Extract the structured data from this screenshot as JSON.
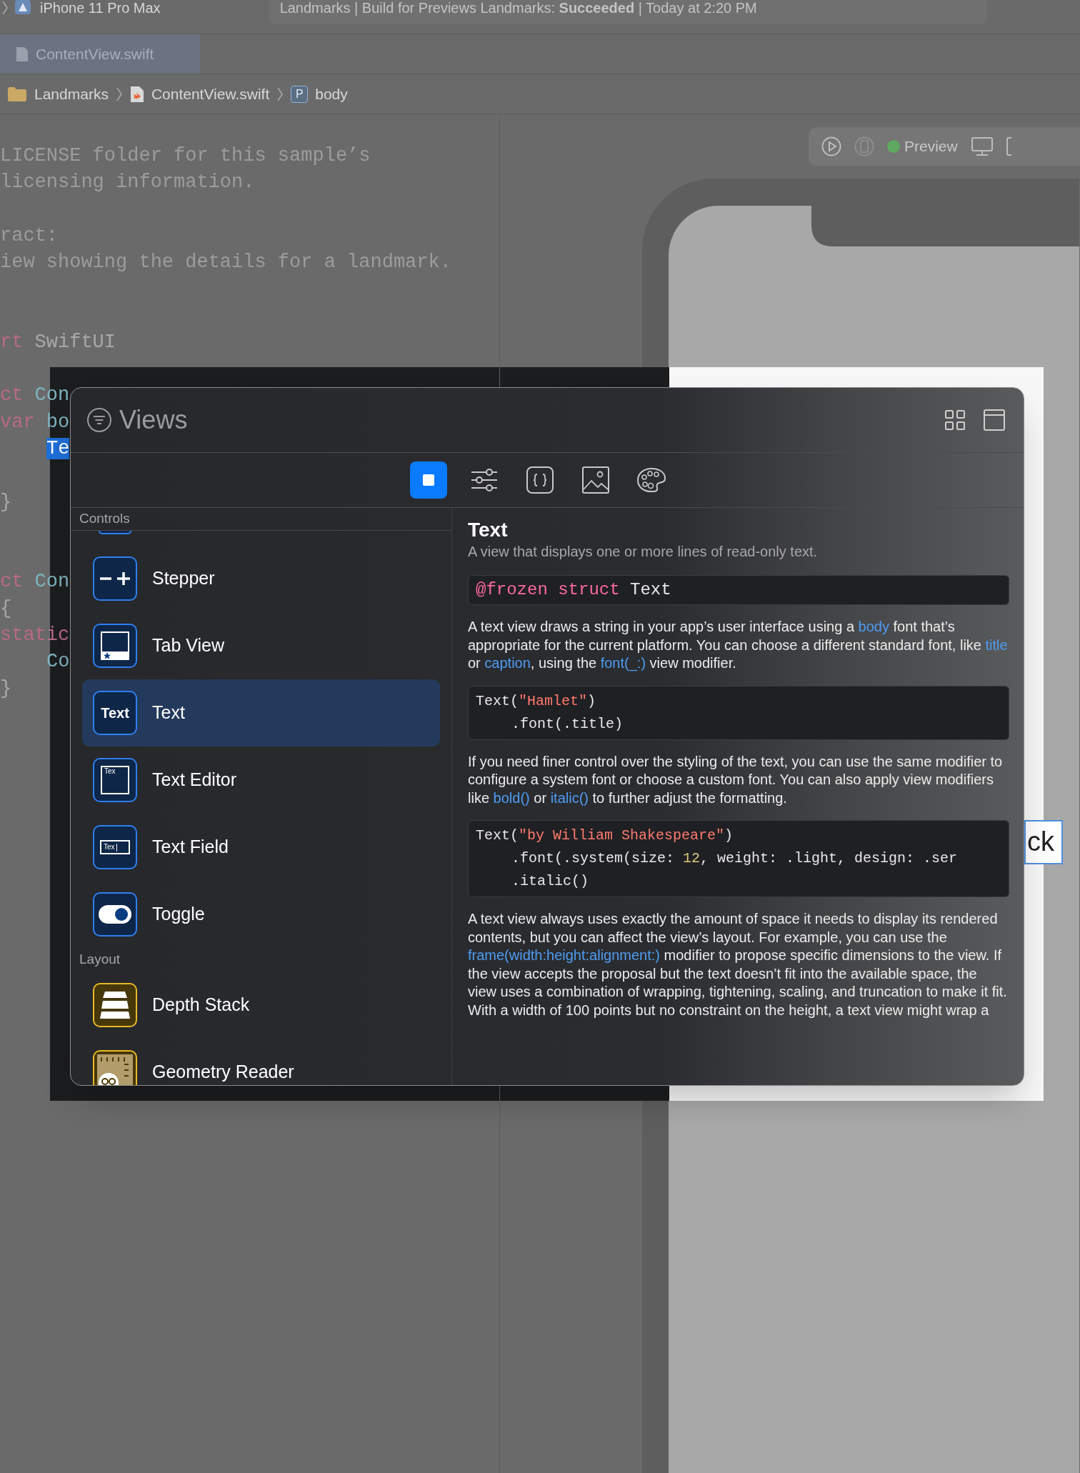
{
  "toolbar": {
    "device": "iPhone 11 Pro Max",
    "status": "Landmarks | Build for Previews Landmarks: **Succeeded** | Today at 2:20 PM"
  },
  "tabs": [
    {
      "label": "ContentView.swift",
      "selected": true
    }
  ],
  "breadcrumb": [
    {
      "label": "Landmarks",
      "kind": "folder"
    },
    {
      "label": "ContentView.swift",
      "kind": "file"
    },
    {
      "label": "body",
      "kind": "property",
      "badge": "P"
    }
  ],
  "editor": {
    "lines": [
      {
        "kind": "code",
        "tokens": [
          {
            "text": "LICENSE folder for this sample’s",
            "kind": "comment"
          }
        ]
      },
      {
        "kind": "code",
        "tokens": [
          {
            "text": "licensing information.",
            "kind": "comment"
          }
        ]
      },
      {
        "kind": "blank"
      },
      {
        "kind": "code",
        "tokens": [
          {
            "text": "ract:",
            "kind": "comment"
          }
        ]
      },
      {
        "kind": "code",
        "tokens": [
          {
            "text": "iew showing the details for a landmark.",
            "kind": "comment"
          }
        ]
      },
      {
        "kind": "blank"
      },
      {
        "kind": "blank"
      },
      {
        "kind": "code",
        "tokens": [
          {
            "text": "rt",
            "kind": "keyword"
          },
          {
            "text": " SwiftUI",
            "kind": "plain"
          }
        ]
      },
      {
        "kind": "blank"
      },
      {
        "kind": "code",
        "tokens": [
          {
            "text": "ct",
            "kind": "keyword"
          },
          {
            "text": " Con",
            "kind": "type"
          }
        ]
      },
      {
        "kind": "code",
        "tokens": [
          {
            "text": "var",
            "kind": "keyword"
          },
          {
            "text": " bo",
            "kind": "type"
          }
        ]
      },
      {
        "kind": "code",
        "indented": true,
        "tokens": [
          {
            "text": "Te",
            "kind": "selected"
          }
        ]
      },
      {
        "kind": "blank"
      },
      {
        "kind": "code",
        "tokens": [
          {
            "text": "}",
            "kind": "plain"
          }
        ]
      },
      {
        "kind": "blank"
      },
      {
        "kind": "blank"
      },
      {
        "kind": "code",
        "tokens": [
          {
            "text": "ct",
            "kind": "keyword"
          },
          {
            "text": " Con",
            "kind": "type"
          }
        ]
      },
      {
        "kind": "code",
        "tokens": [
          {
            "text": "{",
            "kind": "plain"
          }
        ]
      },
      {
        "kind": "code",
        "tokens": [
          {
            "text": "static",
            "kind": "keyword"
          }
        ]
      },
      {
        "kind": "code",
        "indented": true,
        "tokens": [
          {
            "text": "Co",
            "kind": "type"
          }
        ]
      },
      {
        "kind": "code",
        "tokens": [
          {
            "text": "}",
            "kind": "plain"
          }
        ]
      }
    ]
  },
  "preview": {
    "status": "Preview",
    "text": "ck"
  },
  "library": {
    "title": "Views",
    "tabs": [
      {
        "kind": "views",
        "selected": true
      },
      {
        "kind": "modifiers",
        "selected": false
      },
      {
        "kind": "snippets",
        "selected": false
      },
      {
        "kind": "media",
        "selected": false
      },
      {
        "kind": "colors",
        "selected": false
      }
    ],
    "sections": [
      {
        "title": "Controls",
        "items": [
          {
            "label": "Stepper",
            "kind": "stepper",
            "color": "#2f7ff0",
            "selected": false
          },
          {
            "label": "Tab View",
            "kind": "tabview",
            "color": "#2f7ff0",
            "selected": false
          },
          {
            "label": "Text",
            "kind": "text",
            "icon_text": "Text",
            "color": "#2f7ff0",
            "selected": true
          },
          {
            "label": "Text Editor",
            "kind": "texteditor",
            "icon_text": "Tex",
            "color": "#2f7ff0",
            "selected": false
          },
          {
            "label": "Text Field",
            "kind": "textfield",
            "icon_text": "Tex",
            "color": "#2f7ff0",
            "selected": false
          },
          {
            "label": "Toggle",
            "kind": "toggle",
            "color": "#2f7ff0",
            "selected": false
          }
        ]
      },
      {
        "title": "Layout",
        "items": [
          {
            "label": "Depth Stack",
            "kind": "depthstack",
            "color": "#e8b923",
            "selected": false
          },
          {
            "label": "Geometry Reader",
            "kind": "geometryreader",
            "color": "#e8b923",
            "selected": false
          }
        ]
      }
    ],
    "detail": {
      "title": "Text",
      "summary": "A view that displays one or more lines of read-only text.",
      "blocks": [
        {
          "kind": "declaration",
          "lines": [
            {
              "tokens": [
                {
                  "text": "@frozen struct",
                  "kind": "keyword"
                },
                {
                  "text": " Text",
                  "kind": "plain"
                }
              ]
            }
          ]
        },
        {
          "kind": "paragraph",
          "runs": [
            {
              "text": "A text view draws a string in your app’s user interface using a ",
              "link": false
            },
            {
              "text": "body",
              "link": true
            },
            {
              "text": " font that’s appropriate for the current platform. You can choose a different standard font, like ",
              "link": false
            },
            {
              "text": "title",
              "link": true
            },
            {
              "text": " or ",
              "link": false
            },
            {
              "text": "caption",
              "link": true
            },
            {
              "text": ", using the ",
              "link": false
            },
            {
              "text": "font(_:)",
              "link": true
            },
            {
              "text": " view modifier.",
              "link": false
            }
          ]
        },
        {
          "kind": "code",
          "lines": [
            {
              "tokens": [
                {
                  "text": "Text(",
                  "kind": "plain"
                },
                {
                  "text": "\"Hamlet\"",
                  "kind": "string"
                },
                {
                  "text": ")",
                  "kind": "plain"
                }
              ]
            },
            {
              "indented": true,
              "tokens": [
                {
                  "text": ".font(.title)",
                  "kind": "plain"
                }
              ]
            }
          ]
        },
        {
          "kind": "paragraph",
          "runs": [
            {
              "text": "If you need finer control over the styling of the text, you can use the same modifier to configure a system font or choose a custom font. You can also apply view modifiers like ",
              "link": false
            },
            {
              "text": "bold()",
              "link": true
            },
            {
              "text": " or ",
              "link": false
            },
            {
              "text": "italic()",
              "link": true
            },
            {
              "text": " to further adjust the formatting.",
              "link": false
            }
          ]
        },
        {
          "kind": "code",
          "lines": [
            {
              "tokens": [
                {
                  "text": "Text(",
                  "kind": "plain"
                },
                {
                  "text": "\"by William Shakespeare\"",
                  "kind": "string"
                },
                {
                  "text": ")",
                  "kind": "plain"
                }
              ]
            },
            {
              "indented": true,
              "tokens": [
                {
                  "text": ".font(.system(size: ",
                  "kind": "plain"
                },
                {
                  "text": "12",
                  "kind": "number"
                },
                {
                  "text": ", weight: .light, design: .ser",
                  "kind": "plain"
                }
              ]
            },
            {
              "indented": true,
              "tokens": [
                {
                  "text": ".italic()",
                  "kind": "plain"
                }
              ]
            }
          ]
        },
        {
          "kind": "paragraph",
          "runs": [
            {
              "text": "A text view always uses exactly the amount of space it needs to display its rendered contents, but you can affect the view’s layout. For example, you can use the ",
              "link": false
            },
            {
              "text": "frame(width:height:alignment:)",
              "link": true
            },
            {
              "text": " modifier to propose specific dimensions to the view. If the view accepts the proposal but the text doesn’t fit into the available space, the view uses a combination of wrapping, tightening, scaling, and truncation to make it fit. With a width of 100 points but no constraint on the height, a text view might wrap a",
              "link": false
            }
          ]
        }
      ]
    }
  }
}
